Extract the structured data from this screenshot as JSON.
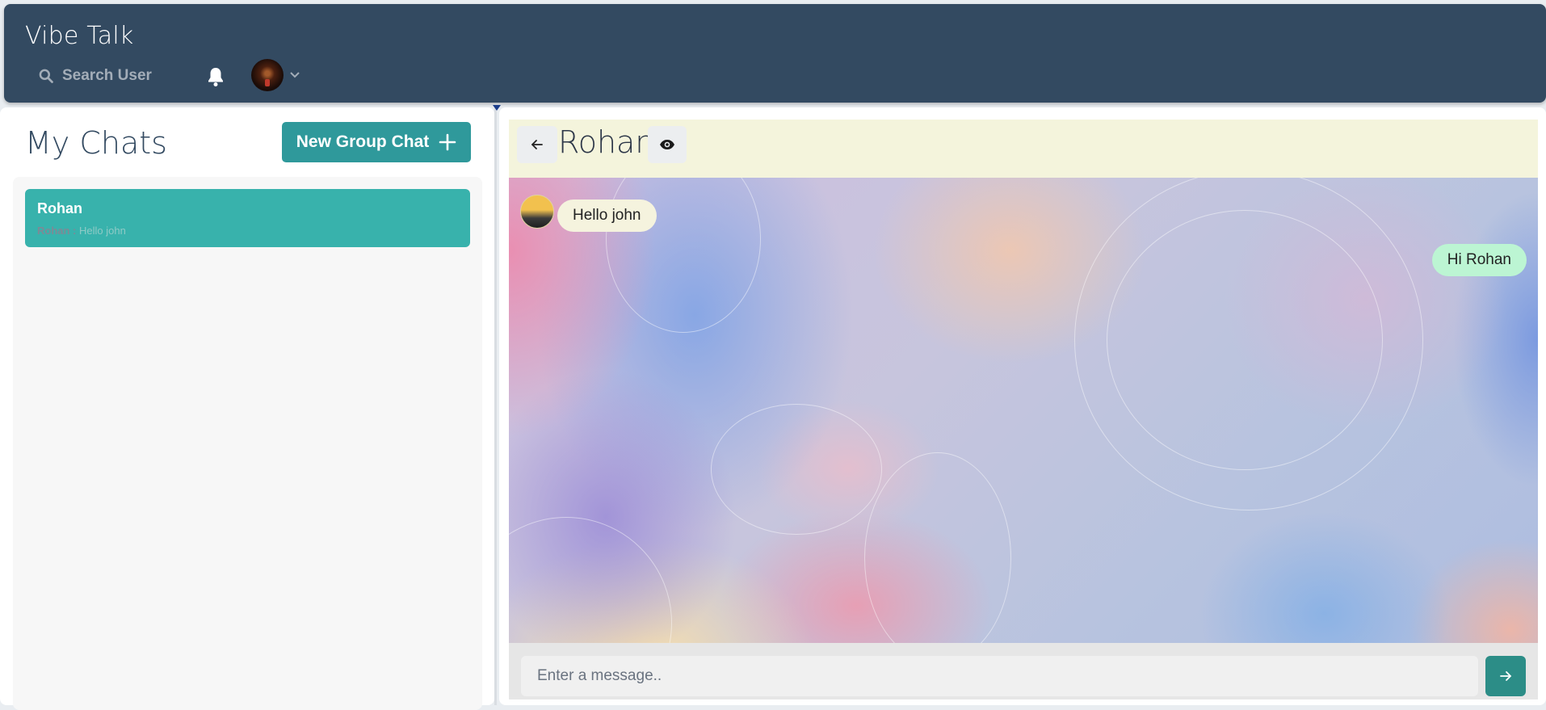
{
  "app": {
    "title": "Vibe Talk"
  },
  "header": {
    "search_label": "Search User",
    "bell_icon": "bell-icon",
    "search_icon": "search-icon",
    "profile_menu_icon": "chevron-down-icon"
  },
  "sidebar": {
    "title": "My Chats",
    "new_group_label": "New Group Chat",
    "chats": [
      {
        "name": "Rohan",
        "last_sender": "Rohan :",
        "last_message": "Hello john"
      }
    ]
  },
  "chat": {
    "title": "Rohan",
    "messages": [
      {
        "text": "Hello john",
        "direction": "incoming"
      },
      {
        "text": "Hi Rohan",
        "direction": "outgoing"
      }
    ],
    "input_placeholder": "Enter a message.."
  },
  "colors": {
    "header_bg": "#334a61",
    "accent": "#38b2ac",
    "button": "#2f999b",
    "send_button": "#2c8d87",
    "incoming_bubble": "#f5f3de",
    "outgoing_bubble": "#bcf5d3"
  }
}
